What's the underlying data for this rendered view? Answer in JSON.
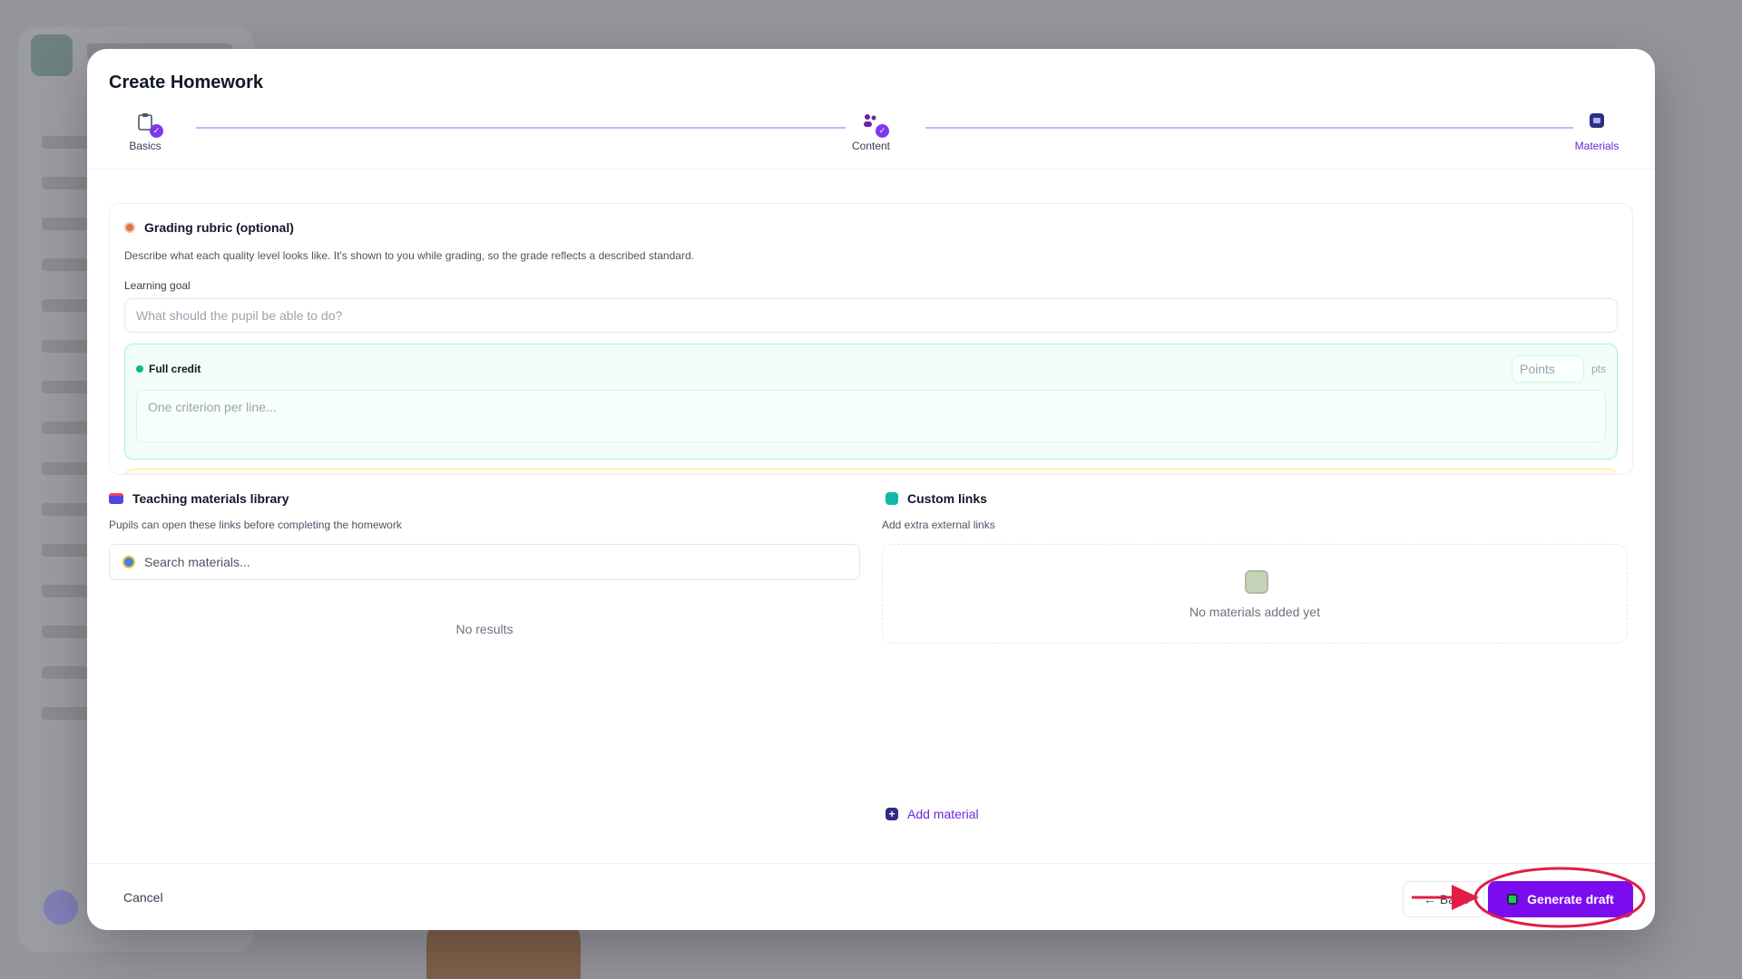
{
  "modal": {
    "title": "Create Homework",
    "steps": [
      {
        "label": "Basics",
        "done": true
      },
      {
        "label": "Content",
        "done": true
      },
      {
        "label": "Materials",
        "active": true
      }
    ]
  },
  "rubric": {
    "title": "Grading rubric (optional)",
    "description": "Describe what each quality level looks like. It's shown to you while grading, so the grade reflects a described standard.",
    "goal_label": "Learning goal",
    "goal_placeholder": "What should the pupil be able to do?",
    "full_credit_label": "Full credit",
    "points_placeholder": "Points",
    "points_unit": "pts",
    "criteria_placeholder": "One criterion per line..."
  },
  "library": {
    "title": "Teaching materials library",
    "description": "Pupils can open these links before completing the homework",
    "search_placeholder": "Search materials...",
    "no_results": "No results"
  },
  "custom_links": {
    "title": "Custom links",
    "description": "Add extra external links",
    "empty_text": "No materials added yet",
    "add_label": "Add material"
  },
  "footer": {
    "cancel_label": "Cancel",
    "back_label": "← Back",
    "generate_label": "Generate draft"
  },
  "colors": {
    "accent": "#7c0cf0",
    "annotation": "#e11d48"
  }
}
